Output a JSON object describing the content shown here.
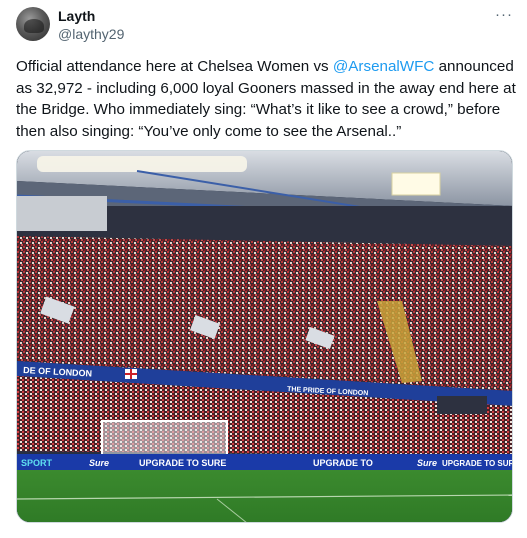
{
  "author": {
    "display_name": "Layth",
    "handle": "@laythy29"
  },
  "menu": {
    "more_icon": "···"
  },
  "tweet": {
    "text_part1": "Official attendance here at Chelsea Women vs ",
    "mention": "@ArsenalWFC",
    "text_part2": " announced as 32,972 - including 6,000 loyal Gooners massed in the away end here at the Bridge. Who immediately sing: “What’s it like to see a crowd,” before then also singing: “You’ve only come to see the Arsenal..”"
  },
  "media": {
    "stand_banner_left": "DE OF LONDON",
    "stand_banner_center": "THE PRIDE OF LONDON",
    "ad_board": [
      "SPORT",
      "Sure",
      "UPGRADE TO SURE",
      "UPGRADE TO",
      "Sure",
      "UPGRADE TO SURE"
    ]
  }
}
